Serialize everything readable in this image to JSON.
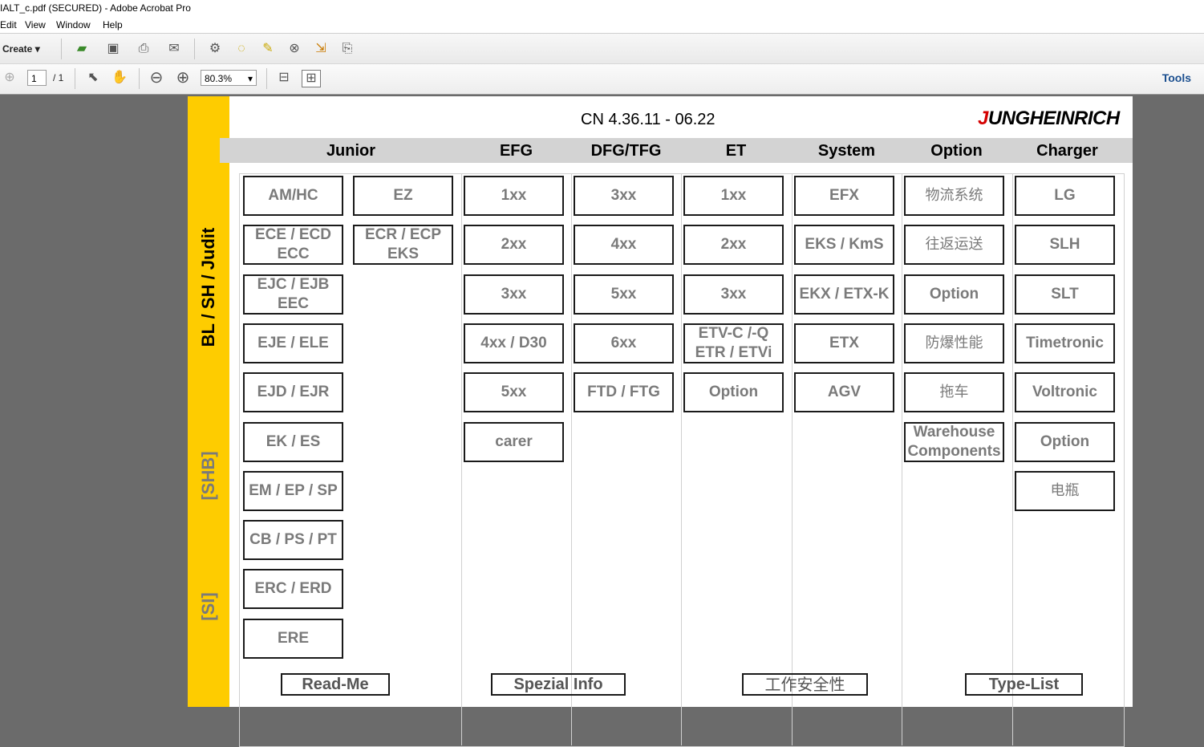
{
  "window": {
    "title": "IALT_c.pdf (SECURED) - Adobe Acrobat Pro"
  },
  "menu": [
    "Edit",
    "View",
    "Window",
    "Help"
  ],
  "toolbar": {
    "create_label": "Create",
    "page_current": "1",
    "page_total": "/ 1",
    "zoom": "80.3%",
    "tools_label": "Tools"
  },
  "doc": {
    "title": "CN 4.36.11  -  06.22",
    "logo": "JUNGHEINRICH",
    "side_labels": [
      "BL / SH / Judit",
      "[SHB]",
      "[SI]"
    ],
    "headers": [
      "Junior",
      "EFG",
      "DFG/TFG",
      "ET",
      "System",
      "Option",
      "Charger"
    ],
    "columns": [
      [
        "AM/HC",
        "ECE / ECD\nECC",
        "EJC / EJB\nEEC",
        "EJE / ELE",
        "EJD / EJR",
        "EK / ES",
        "EM / EP / SP",
        "CB / PS / PT",
        "ERC / ERD",
        "ERE"
      ],
      [
        "EZ",
        "ECR / ECP\nEKS"
      ],
      [
        "1xx",
        "2xx",
        "3xx",
        "4xx / D30",
        "5xx",
        "carer"
      ],
      [
        "3xx",
        "4xx",
        "5xx",
        "6xx",
        "FTD / FTG"
      ],
      [
        "1xx",
        "2xx",
        "3xx",
        "ETV-C /-Q\nETR / ETVi",
        "Option"
      ],
      [
        "EFX",
        "EKS / KmS",
        "EKX / ETX-K",
        "ETX",
        "AGV"
      ],
      [
        "物流系统",
        "往返运送",
        "Option",
        "防爆性能",
        "拖车",
        "Warehouse\nComponents"
      ],
      [
        "LG",
        "SLH",
        "SLT",
        "Timetronic",
        "Voltronic",
        "Option",
        "电瓶"
      ]
    ],
    "footer": [
      "Read-Me",
      "Spezial Info",
      "工作安全性",
      "Type-List"
    ]
  }
}
